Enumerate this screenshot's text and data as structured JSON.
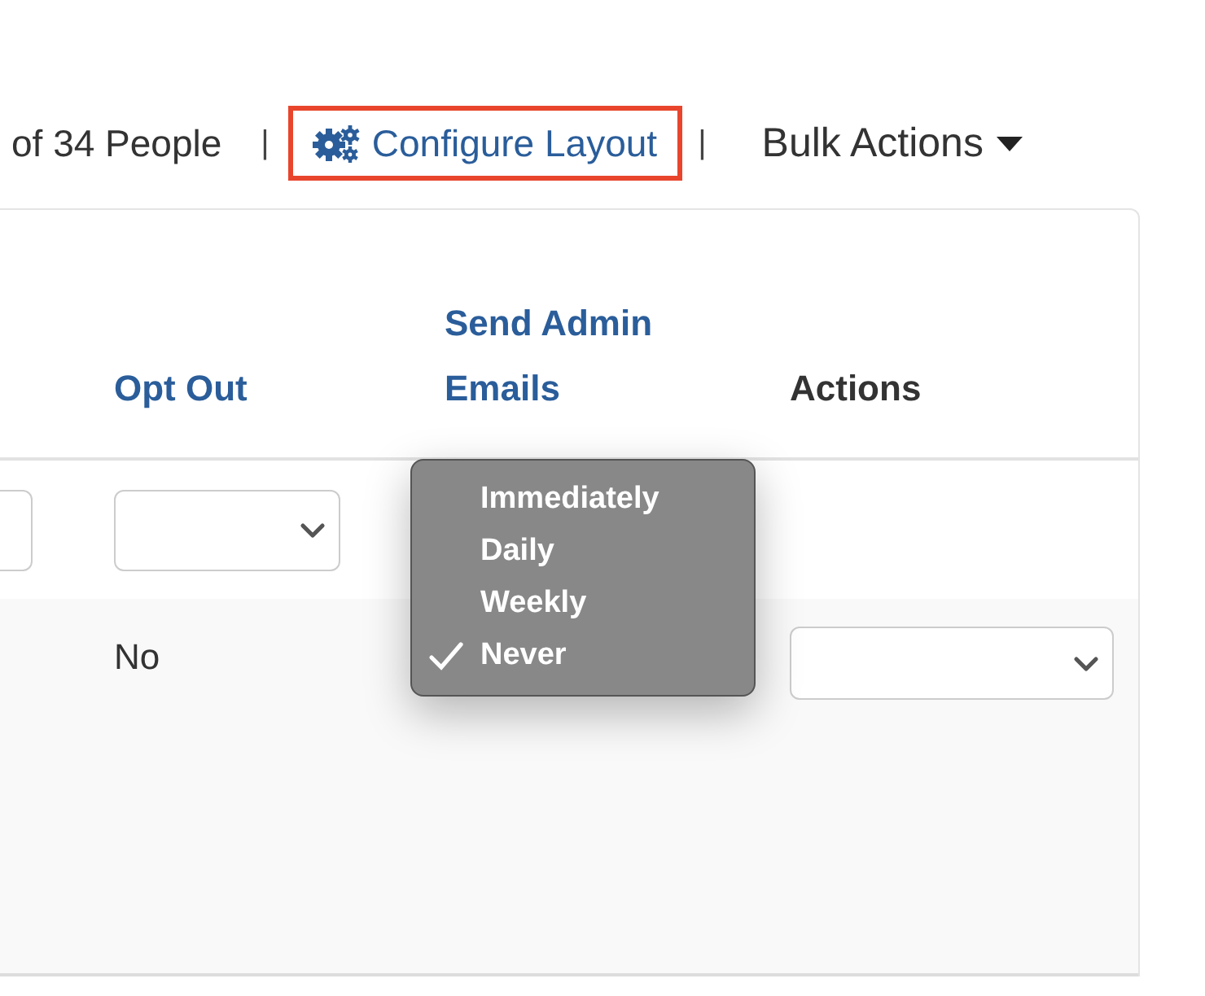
{
  "toolbar": {
    "count_text": "of 34 People",
    "separator_1": "|",
    "configure_layout": {
      "label": "Configure Layout",
      "highlighted": true
    },
    "separator_2": "|",
    "bulk_actions": "Bulk Actions"
  },
  "table": {
    "columns": [
      {
        "label": "Opt Out",
        "sortable": true
      },
      {
        "label": "Send Admin Emails",
        "sortable": true
      },
      {
        "label": "Actions",
        "sortable": false
      }
    ],
    "rows": [
      {
        "opt_out": "No"
      }
    ]
  },
  "dropdown_menu": {
    "items": [
      {
        "label": "Immediately",
        "selected": false
      },
      {
        "label": "Daily",
        "selected": false
      },
      {
        "label": "Weekly",
        "selected": false
      },
      {
        "label": "Never",
        "selected": true
      }
    ]
  }
}
